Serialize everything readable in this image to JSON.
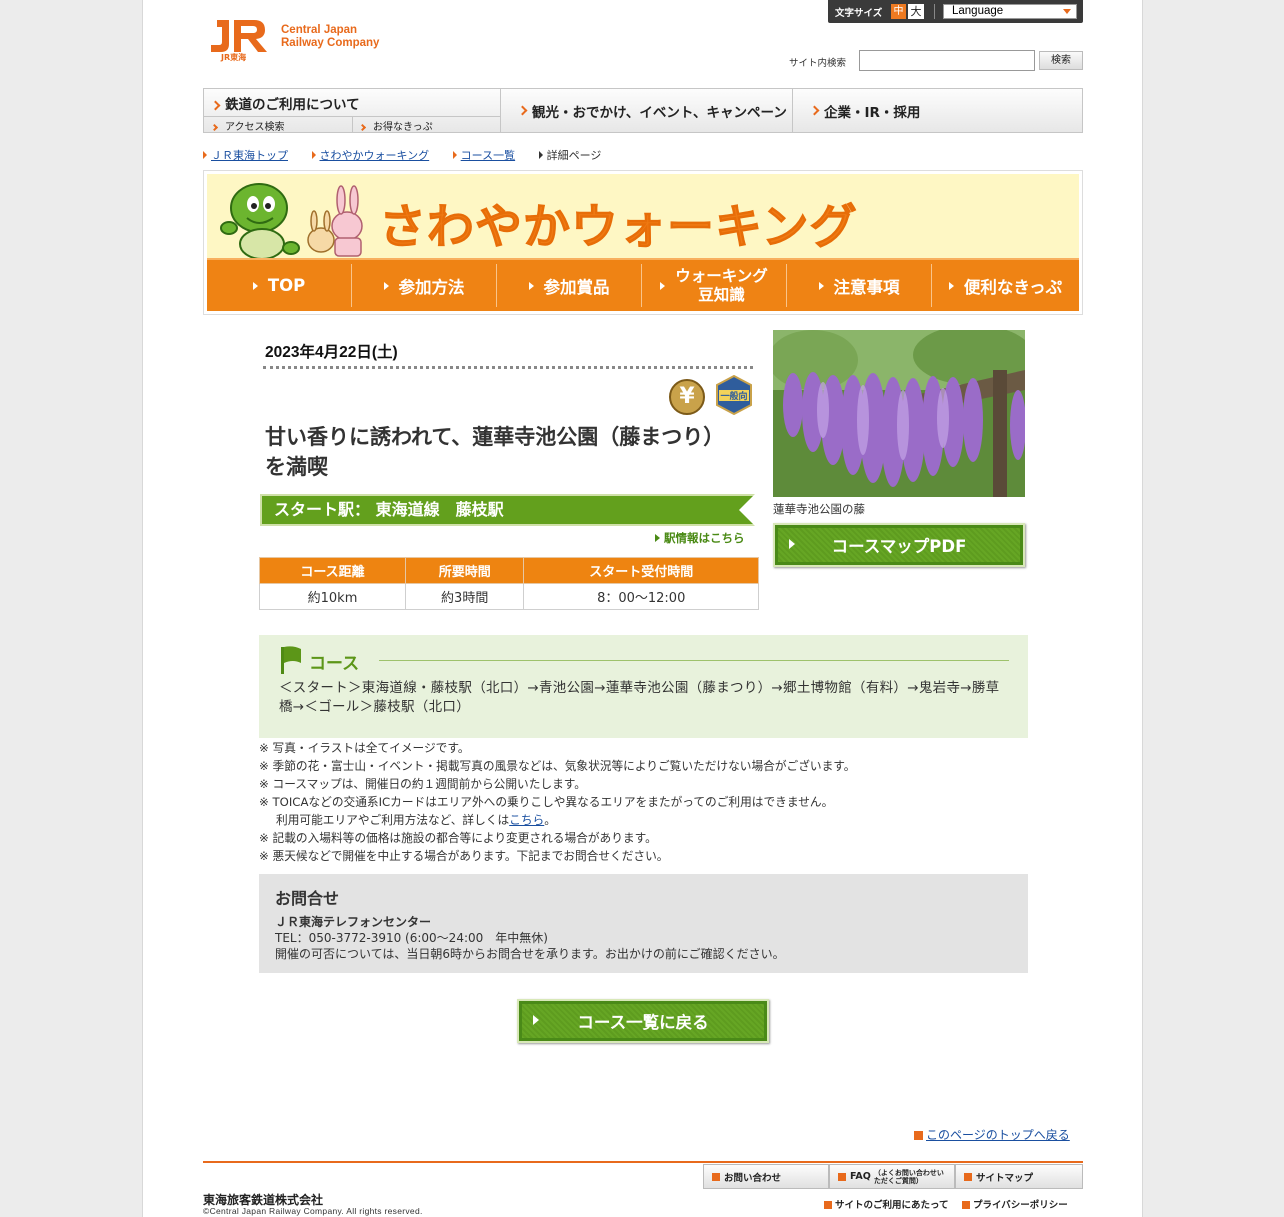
{
  "header": {
    "logo_text_line1": "Central Japan",
    "logo_text_line2": "Railway Company",
    "logo_sub": "JR東海",
    "font_size_label": "文字サイズ",
    "font_size_mid": "中",
    "font_size_big": "大",
    "language_select": "Language",
    "search_label": "サイト内検索",
    "search_value": "",
    "search_button": "検索"
  },
  "global_nav": {
    "rail": "鉄道のご利用について",
    "access": "アクセス検索",
    "tickets": "お得なきっぷ",
    "tourism": "観光・おでかけ、イベント、キャンペーン",
    "corporate": "企業・IR・採用"
  },
  "breadcrumb": [
    "ＪＲ東海トップ",
    "さわやかウォーキング",
    "コース一覧",
    "詳細ページ"
  ],
  "banner": {
    "title": "さわやかウォーキング",
    "nav": [
      "TOP",
      "参加方法",
      "参加賞品",
      "ウォーキング\n豆知識",
      "注意事項",
      "便利なきっぷ"
    ]
  },
  "event": {
    "date": "2023年4月22日(土)",
    "badge_yen": "¥",
    "badge_general": "一般向",
    "title": "甘い香りに誘われて、蓮華寺池公園（藤まつり）を満喫",
    "start_station": "スタート駅：  東海道線　藤枝駅",
    "station_info_link": "駅情報はこちら",
    "table_headers": [
      "コース距離",
      "所要時間",
      "スタート受付時間"
    ],
    "table_values": [
      "約10km",
      "約3時間",
      "8：00～12:00"
    ],
    "photo_caption": "蓮華寺池公園の藤",
    "pdf_button": "コースマップPDF"
  },
  "course": {
    "heading": "コース",
    "route": "＜スタート＞東海道線・藤枝駅（北口）→青池公園→蓮華寺池公園（藤まつり）→郷土博物館（有料）→鬼岩寺→勝草橋→＜ゴール＞藤枝駅（北口）"
  },
  "notes": [
    "※ 写真・イラストは全てイメージです。",
    "※ 季節の花・富士山・イベント・掲載写真の風景などは、気象状況等によりご覧いただけない場合がございます。",
    "※ コースマップは、開催日の約１週間前から公開いたします。",
    "※ TOICAなどの交通系ICカードはエリア外への乗りこしや異なるエリアをまたがってのご利用はできません。",
    "※ 記載の入場料等の価格は施設の都合等により変更される場合があります。",
    "※ 悪天候などで開催を中止する場合があります。下記までお問合せください。"
  ],
  "notes_ic_sub_prefix": "利用可能エリアやご利用方法など、詳しくは",
  "notes_ic_sub_link": "こちら",
  "notes_ic_sub_suffix": "。",
  "contact": {
    "heading": "お問合せ",
    "center": "ＪＲ東海テレフォンセンター",
    "tel": "TEL：050-3772-3910 (6:00～24:00　年中無休)",
    "note": "開催の可否については、当日朝6時からお問合せを承ります。お出かけの前にご確認ください。"
  },
  "back_button": "コース一覧に戻る",
  "to_top": "このページのトップへ戻る",
  "footer": {
    "company": "東海旅客鉄道株式会社",
    "copyright": "©Central Japan Railway Company. All rights reserved.",
    "inquiry": "お問い合わせ",
    "faq": "FAQ",
    "faq_sub": "（よくお問い合わせいただくご質問）",
    "sitemap": "サイトマップ",
    "terms": "サイトのご利用にあたって",
    "privacy": "プライバシーポリシー"
  },
  "colors": {
    "accent_orange": "#e86a1c",
    "green": "#63a01d",
    "banner_bg": "#fef7c4"
  }
}
